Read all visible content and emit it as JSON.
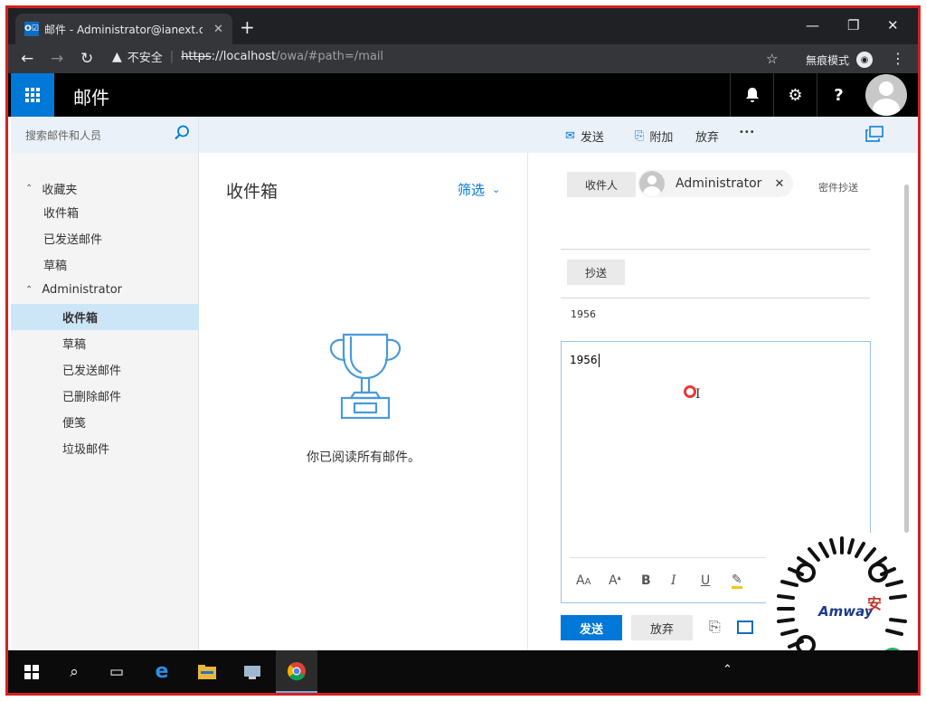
{
  "browser": {
    "tab_title": "邮件 - Administrator@ianext.c",
    "tab_favicon_label": "O☑",
    "security_label": "不安全",
    "url_scheme": "https",
    "url_host": "://localhost",
    "url_path": "/owa/#path=/mail",
    "incognito_label": "無痕模式"
  },
  "owa": {
    "app_title": "邮件"
  },
  "search": {
    "placeholder": "搜索邮件和人员"
  },
  "commands": {
    "send": "发送",
    "attach": "附加",
    "discard": "放弃",
    "more": "•••"
  },
  "leftnav": {
    "favorites_header": "收藏夹",
    "favorites": [
      "收件箱",
      "已发送邮件",
      "草稿"
    ],
    "account_header": "Administrator",
    "folders": [
      "收件箱",
      "草稿",
      "已发送邮件",
      "已删除邮件",
      "便笺",
      "垃圾邮件"
    ],
    "selected_folder": "收件箱"
  },
  "inbox": {
    "title": "收件箱",
    "filter_label": "筛选",
    "empty_message": "你已阅读所有邮件。"
  },
  "compose": {
    "to_label": "收件人",
    "recipient_name": "Administrator",
    "bcc_label": "密件抄送",
    "cc_label": "抄送",
    "subject": "1956",
    "body": "1956",
    "send_label": "发送",
    "discard_label": "放弃"
  },
  "colors": {
    "accent": "#0078d7",
    "header_bg": "#000000",
    "frame_border": "#d42020"
  }
}
